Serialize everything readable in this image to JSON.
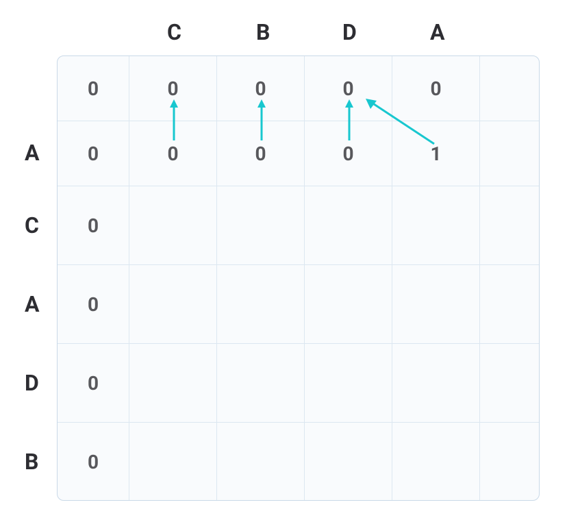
{
  "columnHeaders": [
    "C",
    "B",
    "D",
    "A"
  ],
  "rowHeaders": [
    "A",
    "C",
    "A",
    "D",
    "B"
  ],
  "cells": {
    "r0": [
      "0",
      "0",
      "0",
      "0",
      "0",
      ""
    ],
    "r1": [
      "0",
      "0",
      "0",
      "0",
      "1",
      ""
    ],
    "r2": [
      "0",
      "",
      "",
      "",
      "",
      ""
    ],
    "r3": [
      "0",
      "",
      "",
      "",
      "",
      ""
    ],
    "r4": [
      "0",
      "",
      "",
      "",
      "",
      ""
    ],
    "r5": [
      "0",
      "",
      "",
      "",
      "",
      ""
    ]
  },
  "arrows": [
    {
      "type": "up",
      "col": 1
    },
    {
      "type": "up",
      "col": 2
    },
    {
      "type": "up",
      "col": 3
    },
    {
      "type": "diag",
      "fromCol": 4,
      "toCol": 3
    }
  ],
  "colors": {
    "arrow": "#18c7cf",
    "bg": "#f9fbfd",
    "border": "#c9d9e8",
    "text": "#58585c",
    "label": "#2d2d32"
  }
}
